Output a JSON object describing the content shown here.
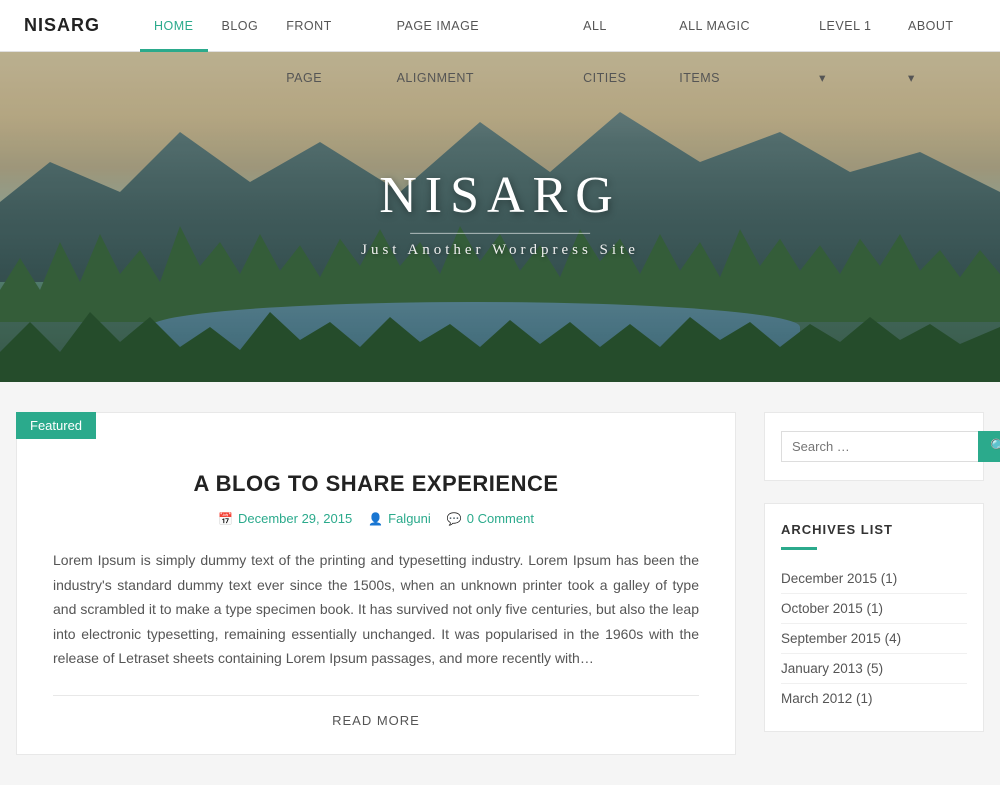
{
  "brand": "NISARG",
  "nav": {
    "links": [
      {
        "label": "HOME",
        "active": true,
        "id": "home"
      },
      {
        "label": "BLOG",
        "active": false,
        "id": "blog"
      },
      {
        "label": "FRONT PAGE",
        "active": false,
        "id": "front-page"
      },
      {
        "label": "PAGE IMAGE ALIGNMENT",
        "active": false,
        "id": "page-image-alignment"
      },
      {
        "label": "ALL CITIES",
        "active": false,
        "id": "all-cities"
      },
      {
        "label": "ALL MAGIC ITEMS",
        "active": false,
        "id": "all-magic-items"
      },
      {
        "label": "LEVEL 1 ▾",
        "active": false,
        "id": "level1",
        "hasArrow": true
      },
      {
        "label": "ABOUT ▾",
        "active": false,
        "id": "about",
        "hasArrow": true
      }
    ]
  },
  "hero": {
    "title": "NISARG",
    "subtitle": "Just Another Wordpress Site"
  },
  "post": {
    "featured_label": "Featured",
    "title": "A BLOG TO SHARE EXPERIENCE",
    "date": "December 29, 2015",
    "author": "Falguni",
    "comments": "0 Comment",
    "body": "Lorem Ipsum is simply dummy text of the printing and typesetting industry. Lorem Ipsum has been the industry's standard dummy text ever since the 1500s, when an unknown printer took a galley of type and scrambled it to make a type specimen book. It has survived not only five centuries, but also the leap into electronic typesetting, remaining essentially unchanged. It was popularised in the 1960s with the release of Letraset sheets containing Lorem Ipsum passages, and more recently with…",
    "read_more": "READ MORE"
  },
  "sidebar": {
    "search": {
      "placeholder": "Search …"
    },
    "archives": {
      "title": "ARCHIVES LIST",
      "items": [
        {
          "label": "December 2015 (1)"
        },
        {
          "label": "October 2015 (1)"
        },
        {
          "label": "September 2015 (4)"
        },
        {
          "label": "January 2013 (5)"
        },
        {
          "label": "March 2012 (1)"
        }
      ]
    }
  },
  "colors": {
    "accent": "#2baa8c",
    "text_dark": "#222222",
    "text_muted": "#555555"
  }
}
